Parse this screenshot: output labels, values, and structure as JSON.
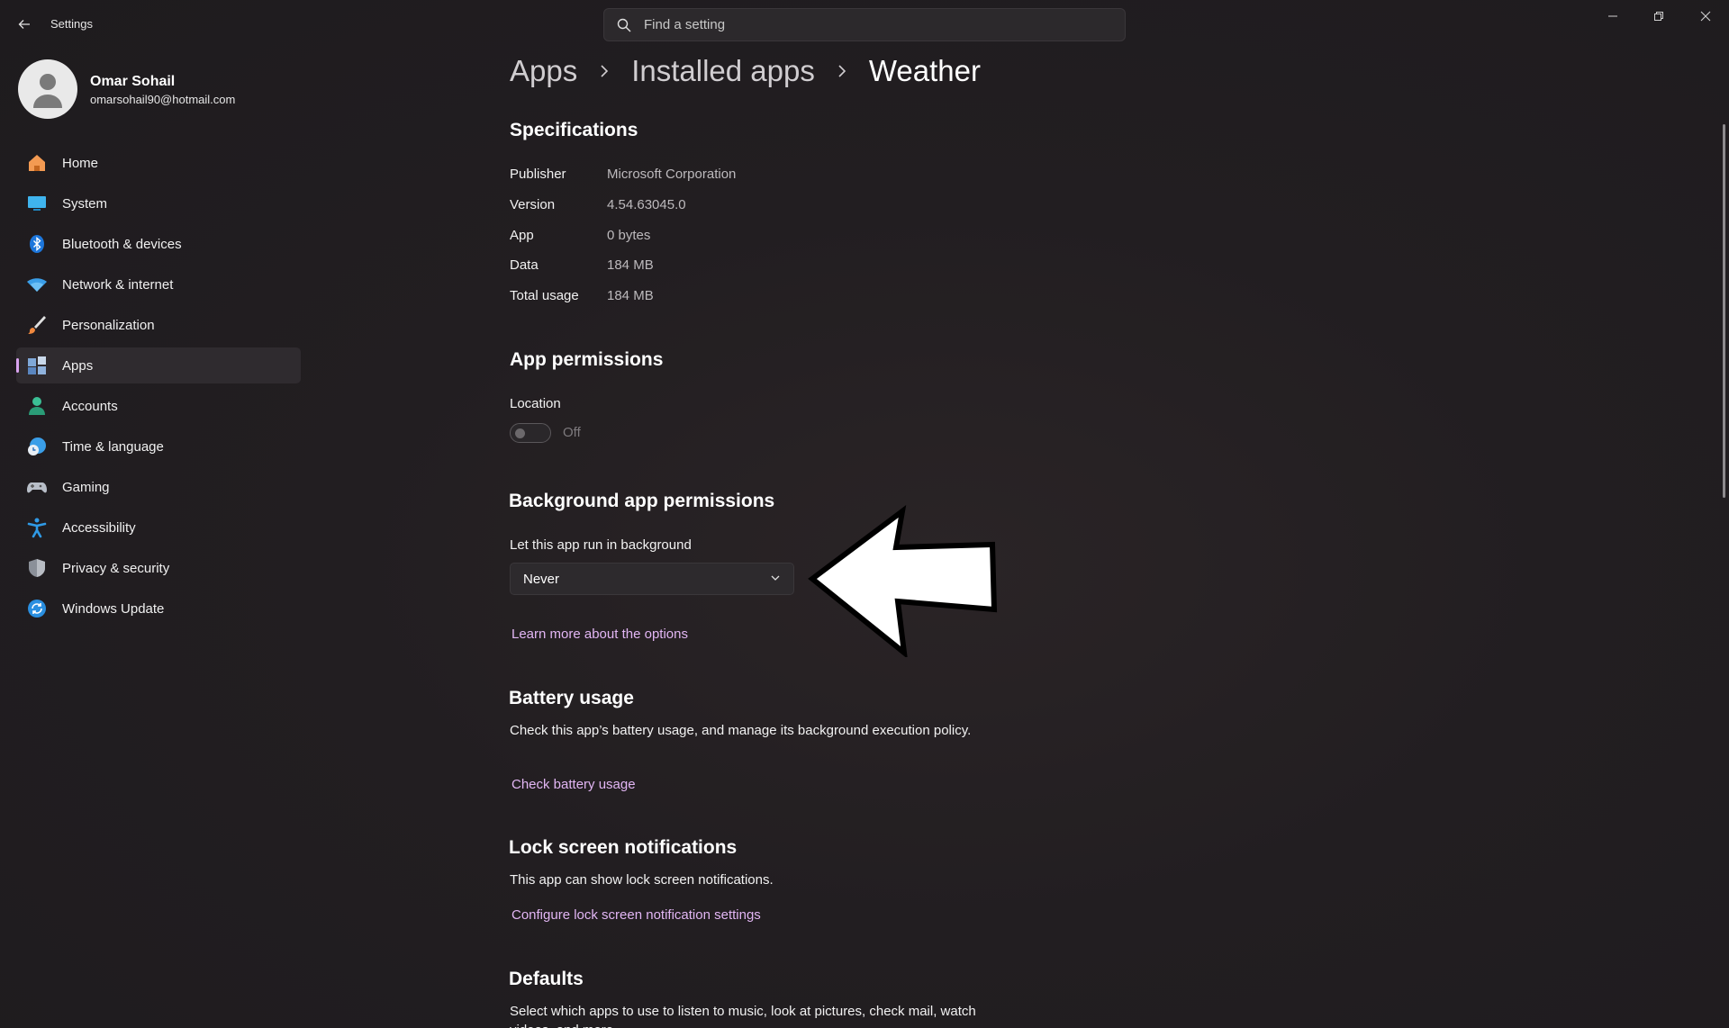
{
  "window": {
    "title": "Settings",
    "search_placeholder": "Find a setting",
    "controls": [
      "minimize-icon",
      "restore-icon",
      "close-icon"
    ]
  },
  "profile": {
    "name": "Omar Sohail",
    "email": "omarsohail90@hotmail.com"
  },
  "sidebar": {
    "items": [
      {
        "label": "Home",
        "icon": "home-icon"
      },
      {
        "label": "System",
        "icon": "system-icon"
      },
      {
        "label": "Bluetooth & devices",
        "icon": "bluetooth-icon"
      },
      {
        "label": "Network & internet",
        "icon": "wifi-icon"
      },
      {
        "label": "Personalization",
        "icon": "brush-icon"
      },
      {
        "label": "Apps",
        "icon": "apps-icon",
        "active": true
      },
      {
        "label": "Accounts",
        "icon": "accounts-icon"
      },
      {
        "label": "Time & language",
        "icon": "clock-globe-icon"
      },
      {
        "label": "Gaming",
        "icon": "controller-icon"
      },
      {
        "label": "Accessibility",
        "icon": "accessibility-icon"
      },
      {
        "label": "Privacy & security",
        "icon": "shield-icon"
      },
      {
        "label": "Windows Update",
        "icon": "update-icon"
      }
    ]
  },
  "breadcrumb": [
    "Apps",
    "Installed apps",
    "Weather"
  ],
  "specifications": {
    "title": "Specifications",
    "rows": [
      {
        "label": "Publisher",
        "value": "Microsoft Corporation"
      },
      {
        "label": "Version",
        "value": "4.54.63045.0"
      },
      {
        "label": "App",
        "value": "0 bytes"
      },
      {
        "label": "Data",
        "value": "184 MB"
      },
      {
        "label": "Total usage",
        "value": "184 MB"
      }
    ]
  },
  "app_permissions": {
    "title": "App permissions",
    "location_label": "Location",
    "location_state": "Off"
  },
  "background": {
    "title": "Background app permissions",
    "label": "Let this app run in background",
    "selected": "Never",
    "link": "Learn more about the options"
  },
  "battery": {
    "title": "Battery usage",
    "description": "Check this app’s battery usage, and manage its background execution policy.",
    "link": "Check battery usage"
  },
  "lock_screen": {
    "title": "Lock screen notifications",
    "description": "This app can show lock screen notifications.",
    "link": "Configure lock screen notification settings"
  },
  "defaults": {
    "title": "Defaults",
    "description": "Select which apps to use to listen to music, look at pictures, check mail, watch videos, and more."
  },
  "colors": {
    "accent": "#d9a3ef",
    "link": "#e2b6f4",
    "background": "#201d20"
  }
}
